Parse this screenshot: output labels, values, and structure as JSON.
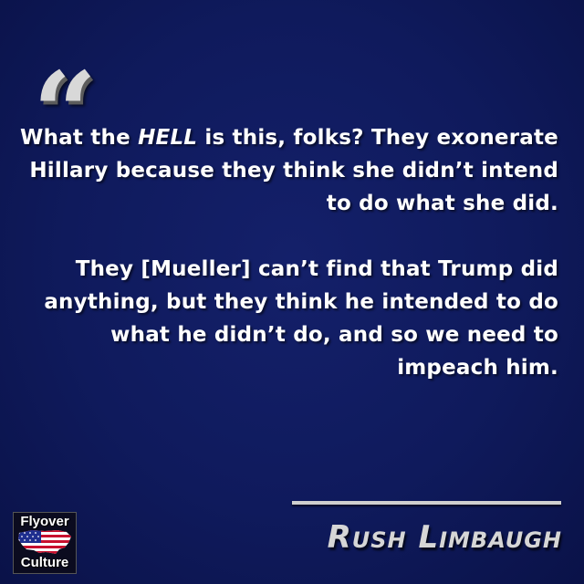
{
  "quote": {
    "open_mark": "“",
    "paragraph1_parts": [
      "What the ",
      "HELL",
      " is this, folks? They exonerate Hillary because they think she didn’t intend to do what she did."
    ],
    "paragraph2": "They [Mueller] can’t find that Trump did anything, but they think he intended to do what he didn’t do, and so we need to impeach him."
  },
  "author": "Rush Limbaugh",
  "logo": {
    "line1": "Flyover",
    "line2": "Culture"
  },
  "colors": {
    "background": "#0f1a5c",
    "text": "#ffffff",
    "accent": "#d6d6d6"
  }
}
